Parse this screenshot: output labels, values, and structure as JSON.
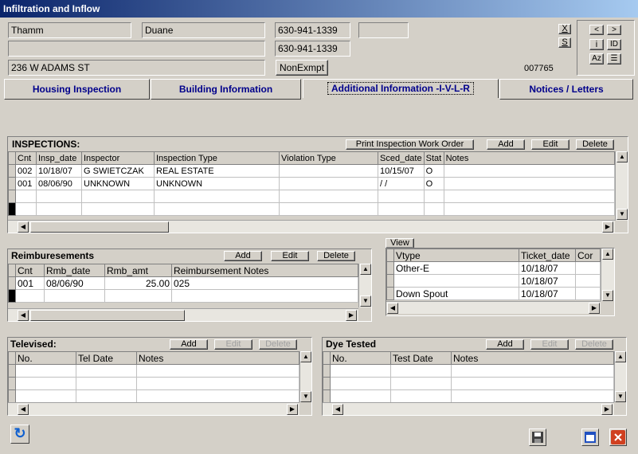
{
  "window": {
    "title": "Infiltration and Inflow"
  },
  "header": {
    "first_name": "Thamm",
    "last_name": "Duane",
    "phone1": "630-941-1339",
    "phone1_extra": "",
    "phone2": "630-941-1339",
    "address2": "",
    "address": "236 W ADAMS ST",
    "exempt_button": "NonExmpt",
    "record_id": "007765",
    "x_button": "X",
    "s_button": "S"
  },
  "nav": {
    "prev": "<",
    "next": ">",
    "info": "i",
    "id": "ID",
    "sort": "Az"
  },
  "tabs": [
    {
      "label": "Housing Inspection"
    },
    {
      "label": "Building Information"
    },
    {
      "label": "Additional Information -I-V-L-R"
    },
    {
      "label": "Notices / Letters"
    }
  ],
  "inspections": {
    "title": "INSPECTIONS:",
    "print_button": "Print Inspection Work Order",
    "add": "Add",
    "edit": "Edit",
    "delete": "Delete",
    "columns": [
      "Cnt",
      "Insp_date",
      "Inspector",
      "Inspection Type",
      "Violation Type",
      "Sced_date",
      "Stat",
      "Notes"
    ],
    "rows": [
      [
        "002",
        "10/18/07",
        "G SWIETCZAK",
        "REAL ESTATE",
        "",
        "10/15/07",
        "O",
        ""
      ],
      [
        "001",
        "08/06/90",
        "UNKNOWN",
        "UNKNOWN",
        "",
        "/  /",
        "O",
        ""
      ],
      [
        "",
        "",
        "",
        "",
        "",
        "",
        "",
        ""
      ],
      [
        "",
        "",
        "",
        "",
        "",
        "",
        "",
        ""
      ]
    ]
  },
  "reimbursements": {
    "title": "Reimburesements",
    "add": "Add",
    "edit": "Edit",
    "delete": "Delete",
    "columns": [
      "Cnt",
      "Rmb_date",
      "Rmb_amt",
      "Reimbursement Notes"
    ],
    "rows": [
      [
        "001",
        "08/06/90",
        "25.00",
        "025"
      ],
      [
        "",
        "",
        "",
        ""
      ]
    ]
  },
  "view": {
    "button": "View",
    "columns": [
      "Vtype",
      "Ticket_date",
      "Cor"
    ],
    "rows": [
      [
        "Other-E",
        "10/18/07",
        ""
      ],
      [
        "",
        "10/18/07",
        ""
      ],
      [
        "Down Spout",
        "10/18/07",
        ""
      ]
    ]
  },
  "televised": {
    "title": "Televised:",
    "add": "Add",
    "edit": "Edit",
    "delete": "Delete",
    "columns": [
      "No.",
      "Tel Date",
      "Notes"
    ]
  },
  "dye": {
    "title": "Dye Tested",
    "add": "Add",
    "edit": "Edit",
    "delete": "Delete",
    "columns": [
      "No.",
      "Test Date",
      "Notes"
    ]
  }
}
